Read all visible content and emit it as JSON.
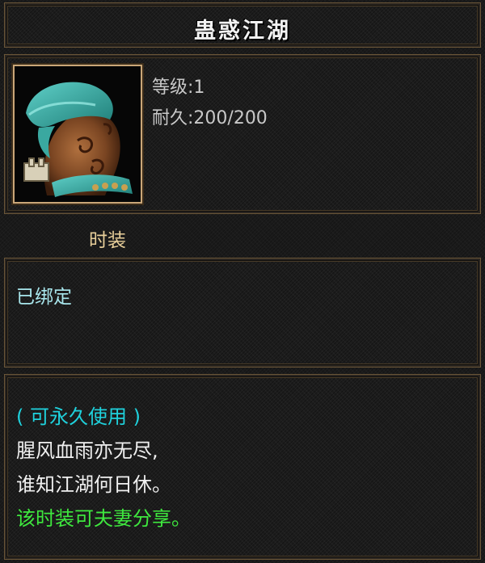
{
  "item": {
    "name": "蛊惑江湖",
    "level_text": "等级:1",
    "durability_text": "耐久:200/200",
    "category": "时装",
    "bind_status": "已绑定",
    "icon": "costume-icon"
  },
  "description": {
    "usage": "( 可永久使用 )",
    "poem_line_1": "腥风血雨亦无尽,",
    "poem_line_2": "谁知江湖何日休。",
    "share_note": "该时装可夫妻分享。"
  },
  "colors": {
    "title": "#f2f2f2",
    "stats": "#c8c8c8",
    "category": "#e8cf9a",
    "bind": "#a8e6ec",
    "usage": "#1fd2dd",
    "poem": "#f0f0f0",
    "share": "#3ee83e",
    "frame_gold": "#c9a678"
  }
}
